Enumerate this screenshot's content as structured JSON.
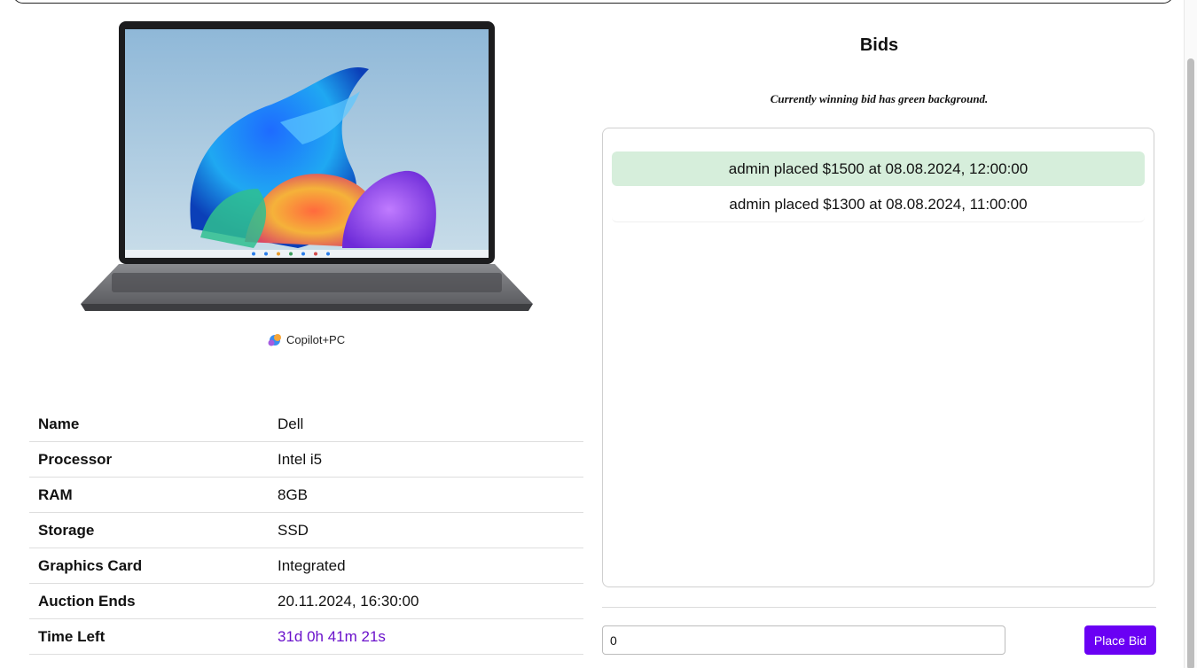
{
  "product": {
    "image_alt": "Dell laptop",
    "badge_text": "Copilot+PC",
    "details": [
      {
        "label": "Name",
        "value": "Dell"
      },
      {
        "label": "Processor",
        "value": "Intel i5"
      },
      {
        "label": "RAM",
        "value": "8GB"
      },
      {
        "label": "Storage",
        "value": "SSD"
      },
      {
        "label": "Graphics Card",
        "value": "Integrated"
      },
      {
        "label": "Auction Ends",
        "value": "20.11.2024, 16:30:00"
      },
      {
        "label": "Time Left",
        "value": "31d 0h 41m 21s"
      }
    ]
  },
  "bids": {
    "title": "Bids",
    "note": "Currently winning bid has green background.",
    "items": [
      {
        "text": "admin placed $1500 at 08.08.2024, 12:00:00",
        "winning": true
      },
      {
        "text": "admin placed $1300 at 08.08.2024, 11:00:00",
        "winning": false
      }
    ],
    "input_value": "0",
    "button_label": "Place Bid"
  },
  "colors": {
    "accent": "#6a00f4",
    "winning_bg": "#d6eedb",
    "countdown": "#6a11cb"
  }
}
